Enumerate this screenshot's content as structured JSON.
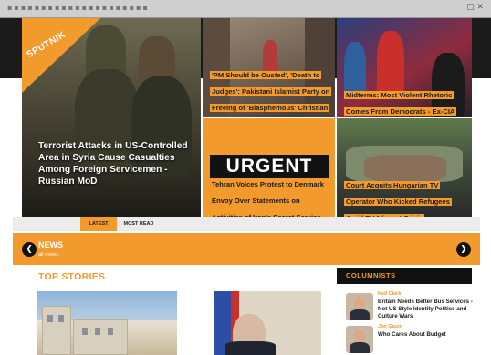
{
  "brand": {
    "logo_text": "SPUTNIK",
    "accent_color": "#f39a2c",
    "dark_color": "#111111"
  },
  "hero": {
    "main_headline": "Terrorist Attacks in US-Controlled Area in Syria Cause Casualties Among Foreign Servicemen - Russian MoD",
    "mid_top_headline": "'PM Should be Ousted', 'Death to Judges': Pakistani Islamist Party on Freeing of 'Blasphemous' Christian Woman",
    "urgent_label": "URGENT",
    "urgent_headline": "Tehran Voices Protest to Denmark Envoy Over Statements on Activities of Iran's Secret Service",
    "right_top_headline": "Midterms: Most Violent Rhetoric Comes From Democrats - Ex-CIA Officer",
    "right_bottom_headline": "Court Acquits Hungarian TV Operator Who Kicked Refugees Amid EU Migrant Crisis"
  },
  "tabs": [
    {
      "label": "LATEST",
      "active": true
    },
    {
      "label": "MOST READ",
      "active": false
    }
  ],
  "news_bar": {
    "title": "NEWS",
    "subtitle": "all news",
    "prev_icon": "chevron-left-icon",
    "next_icon": "chevron-right-icon"
  },
  "top_stories": {
    "heading": "TOP STORIES"
  },
  "columnists": {
    "heading": "COLUMNISTS",
    "items": [
      {
        "name": "Neil Clark",
        "title": "Britain Needs Better Bus Services - Not US Style Identity Politics and Culture Wars"
      },
      {
        "name": "Jon Gaunt",
        "title": "Who Cares About Budget"
      }
    ]
  }
}
